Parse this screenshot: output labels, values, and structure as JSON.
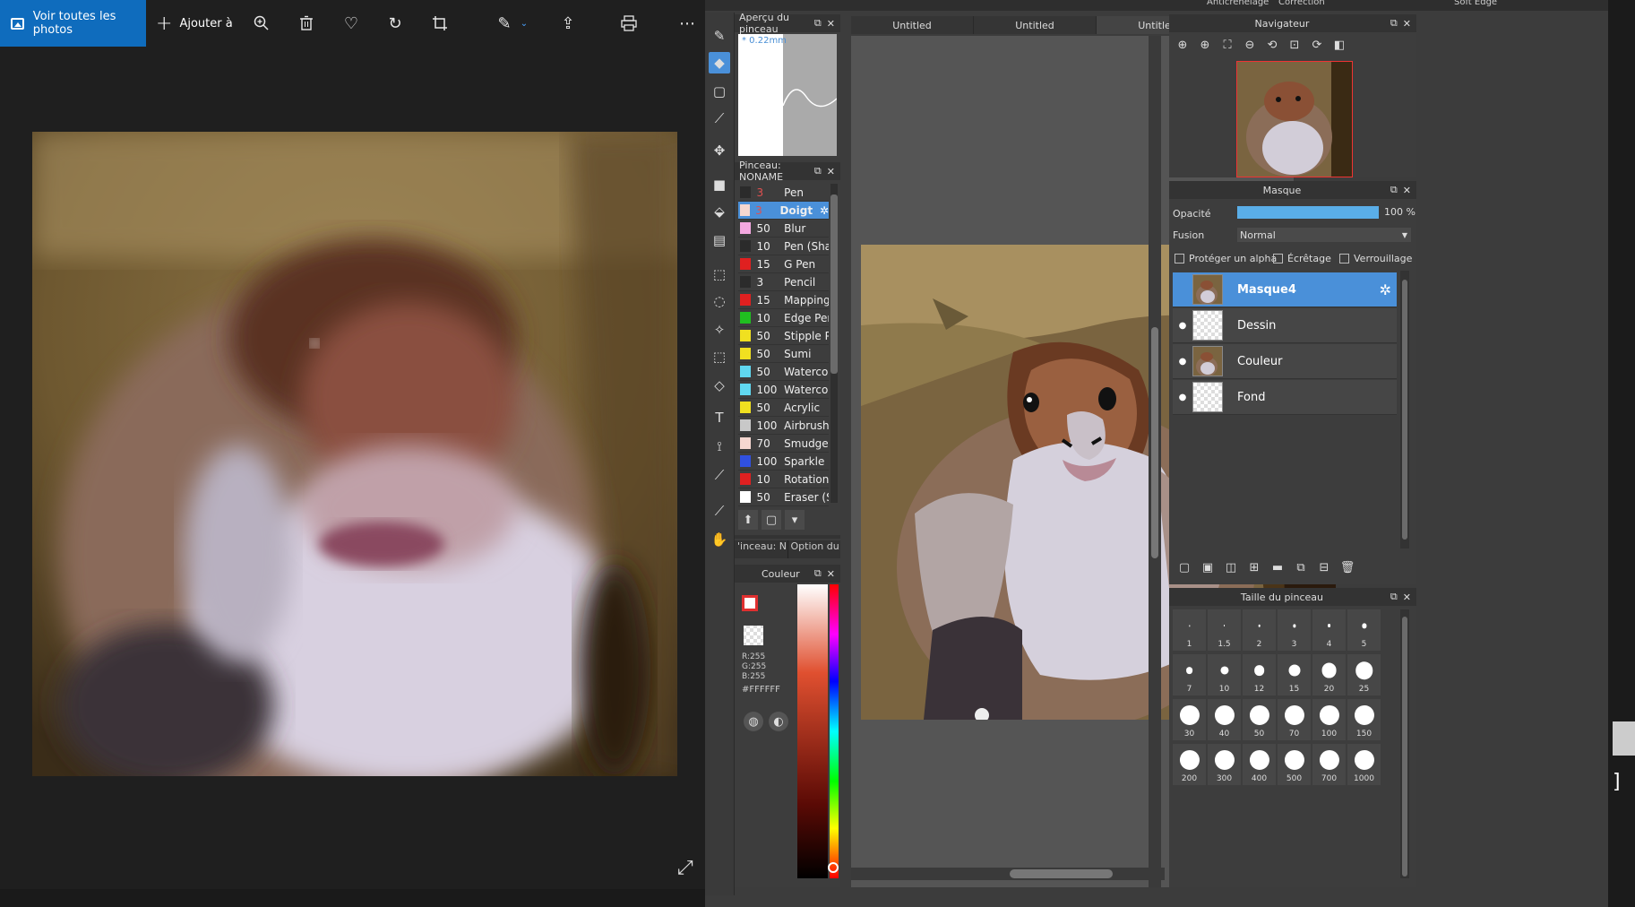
{
  "photos": {
    "all_photos_label": "Voir toutes les photos",
    "add_to_label": "Ajouter à",
    "toolbar_icons": [
      "zoom-in-icon",
      "trash-icon",
      "heart-icon",
      "rotate-icon",
      "crop-icon",
      "edit-icon",
      "share-icon",
      "print-icon",
      "more-icon"
    ]
  },
  "paint": {
    "top_strip": {
      "antialias": "Anticrénelage",
      "correction": "Correction",
      "soft_edge": "Soft Edge"
    },
    "brush_preview": {
      "title": "Aperçu du pinceau",
      "size": "* 0.22mm"
    },
    "brush_list": {
      "title": "Pinceau: NONAME",
      "brushes": [
        {
          "size": "3",
          "name": "Pen",
          "color": "#2b2b2b"
        },
        {
          "size": "3",
          "name": "Doigt",
          "color": "#f5d7d0",
          "selected": true
        },
        {
          "size": "50",
          "name": "Blur",
          "color": "#f4a8e0"
        },
        {
          "size": "10",
          "name": "Pen (Sha",
          "color": "#2b2b2b"
        },
        {
          "size": "15",
          "name": "G Pen",
          "color": "#e02020"
        },
        {
          "size": "3",
          "name": "Pencil",
          "color": "#2b2b2b"
        },
        {
          "size": "15",
          "name": "Mapping I",
          "color": "#e02020"
        },
        {
          "size": "10",
          "name": "Edge Per",
          "color": "#20c020"
        },
        {
          "size": "50",
          "name": "Stipple Pe",
          "color": "#f0e020"
        },
        {
          "size": "50",
          "name": "Sumi",
          "color": "#f0e020"
        },
        {
          "size": "50",
          "name": "Watercol",
          "color": "#60d8f0"
        },
        {
          "size": "100",
          "name": "Watercol",
          "color": "#60d8f0"
        },
        {
          "size": "50",
          "name": "Acrylic",
          "color": "#f0e020"
        },
        {
          "size": "100",
          "name": "Airbrush",
          "color": "#c8c8c8"
        },
        {
          "size": "70",
          "name": "Smudge",
          "color": "#f5d7d0"
        },
        {
          "size": "100",
          "name": "Sparkle B",
          "color": "#3050e0"
        },
        {
          "size": "10",
          "name": "Rotation",
          "color": "#e02020"
        },
        {
          "size": "50",
          "name": "Eraser (S",
          "color": "#ffffff"
        }
      ],
      "tab1": "'inceau: N..",
      "tab2": "Option du ..."
    },
    "color": {
      "title": "Couleur",
      "r": "R:255",
      "g": "G:255",
      "b": "B:255",
      "hex": "#FFFFFF"
    },
    "doc_tabs": [
      "Untitled",
      "Untitled",
      "Untitled"
    ],
    "navigator": {
      "title": "Navigateur"
    },
    "mask": {
      "title": "Masque",
      "opacity_label": "Opacité",
      "opacity_value": "100 %",
      "blend_label": "Fusion",
      "blend_value": "Normal",
      "protect_alpha": "Protéger un alpha",
      "clipping": "Écrêtage",
      "lock": "Verrouillage",
      "layers": [
        {
          "name": "Masque4",
          "selected": true
        },
        {
          "name": "Dessin"
        },
        {
          "name": "Couleur"
        },
        {
          "name": "Fond"
        }
      ]
    },
    "brush_size": {
      "title": "Taille du pinceau",
      "sizes": [
        "1",
        "1.5",
        "2",
        "3",
        "4",
        "5",
        "7",
        "10",
        "12",
        "15",
        "20",
        "25",
        "30",
        "40",
        "50",
        "70",
        "100",
        "150",
        "200",
        "300",
        "400",
        "500",
        "700",
        "1000"
      ]
    }
  },
  "colors": {
    "photos_accent": "#0f6cbd",
    "selection": "#4a90d9"
  }
}
